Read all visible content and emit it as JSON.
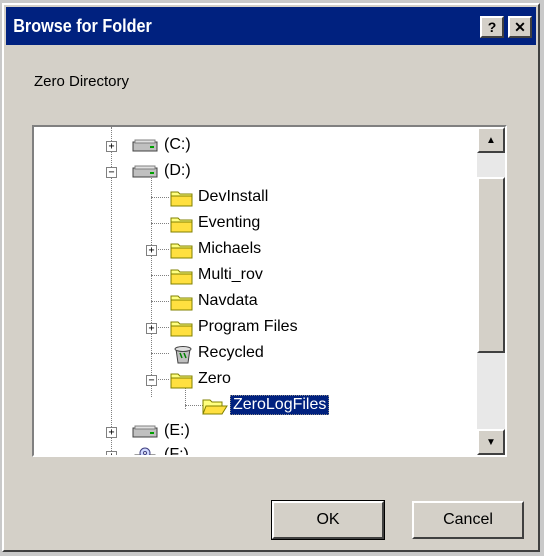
{
  "window": {
    "title": "Browse for Folder",
    "help_button": "?",
    "close_button": "✕"
  },
  "prompt": "Zero Directory",
  "tree": {
    "items": [
      {
        "label": "(C:)",
        "type": "drive",
        "expander": "+"
      },
      {
        "label": "(D:)",
        "type": "drive",
        "expander": "−"
      },
      {
        "label": "DevInstall",
        "type": "folder"
      },
      {
        "label": "Eventing",
        "type": "folder"
      },
      {
        "label": "Michaels",
        "type": "folder",
        "expander": "+"
      },
      {
        "label": "Multi_rov",
        "type": "folder"
      },
      {
        "label": "Navdata",
        "type": "folder"
      },
      {
        "label": "Program Files",
        "type": "folder",
        "expander": "+"
      },
      {
        "label": "Recycled",
        "type": "recycle-bin"
      },
      {
        "label": "Zero",
        "type": "folder",
        "expander": "−"
      },
      {
        "label": "ZeroLogFiles",
        "type": "open-folder",
        "selected": true
      },
      {
        "label": "(E:)",
        "type": "drive",
        "expander": "+"
      },
      {
        "label": "(F:)",
        "type": "cd-drive",
        "expander": "+"
      }
    ]
  },
  "buttons": {
    "ok": "OK",
    "cancel": "Cancel"
  },
  "colors": {
    "titlebar": "#00217f",
    "selection": "#00217f",
    "face": "#d4d0c8"
  }
}
